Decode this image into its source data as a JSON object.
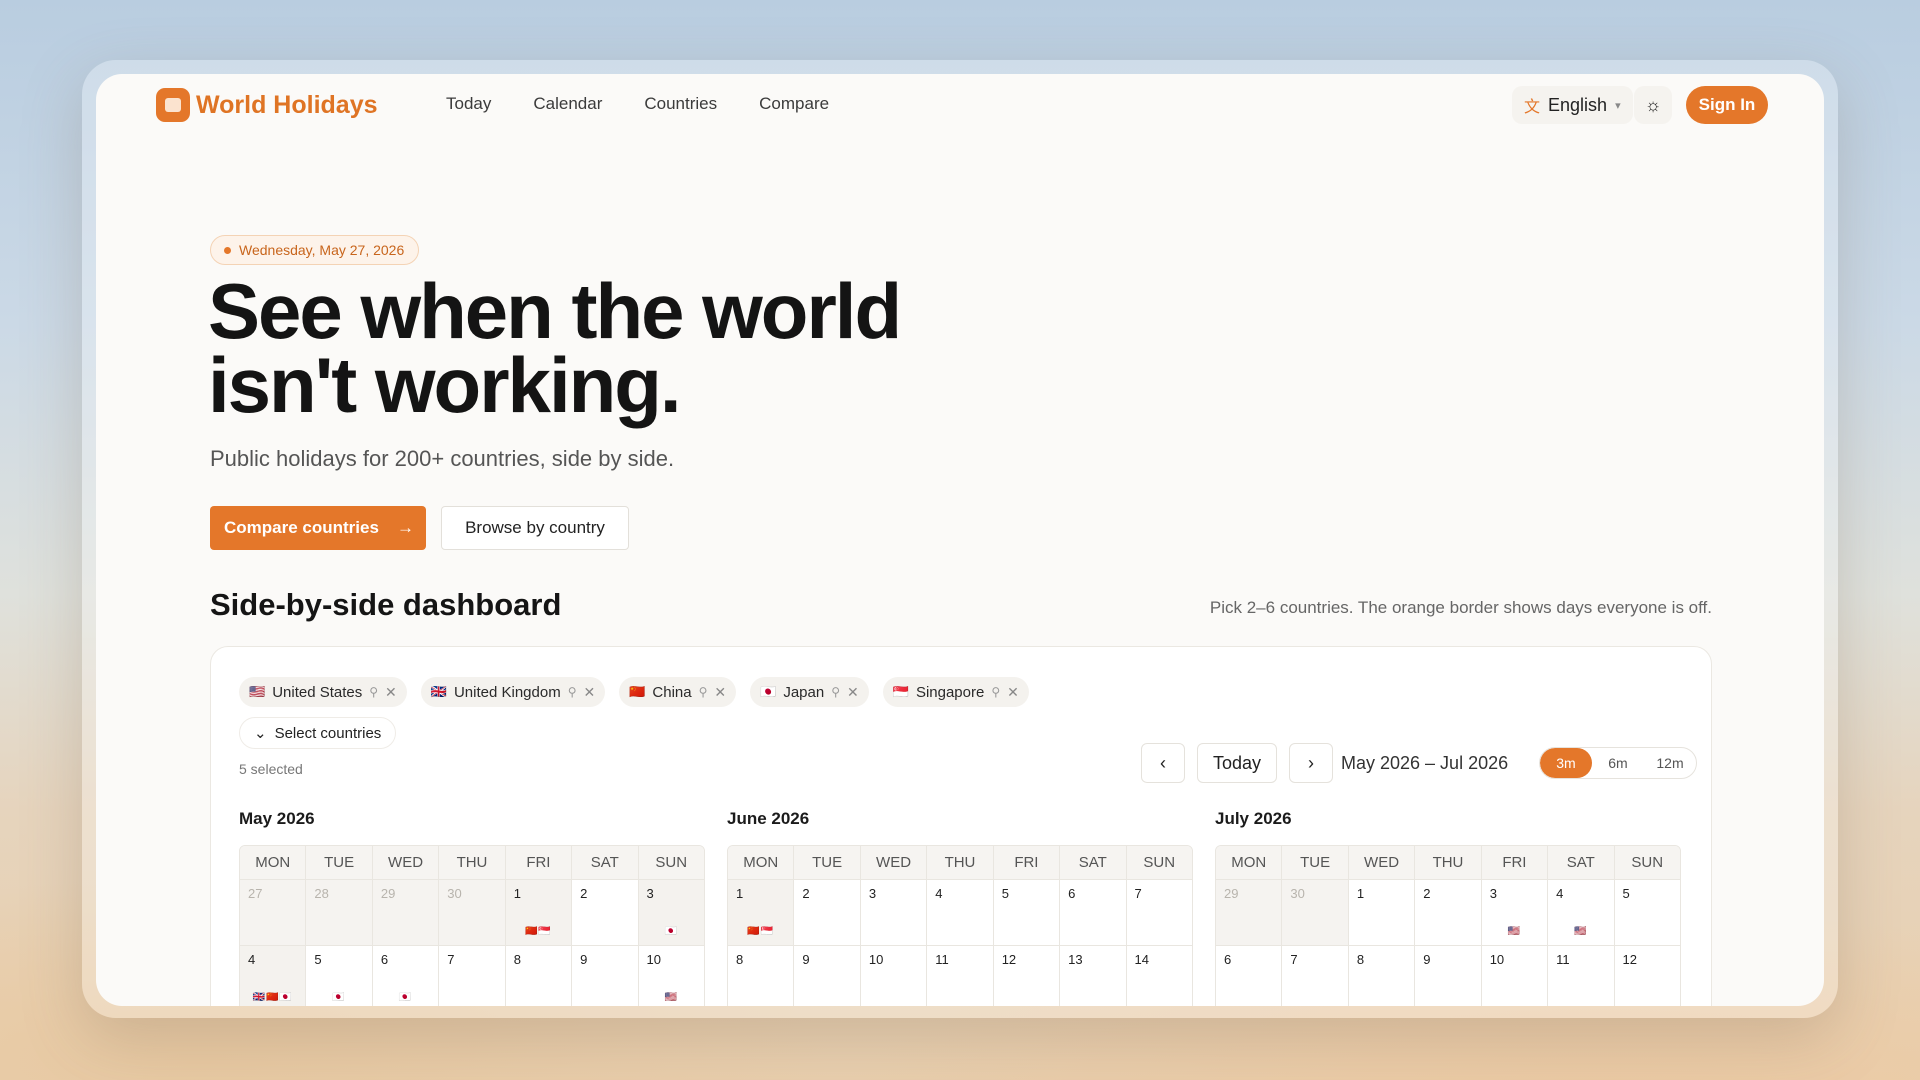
{
  "brand": {
    "name": "World Holidays",
    "accent": "#e4772a"
  },
  "nav": {
    "links": [
      "Today",
      "Calendar",
      "Countries",
      "Compare"
    ],
    "language": "English",
    "sign_in": "Sign In"
  },
  "hero": {
    "date": "Wednesday, May 27, 2026",
    "headline": "See when the world isn't working.",
    "subline": "Public holidays for 200+ countries, side by side.",
    "primary_cta": "Compare countries",
    "secondary_cta": "Browse by country"
  },
  "dashboard": {
    "title": "Side-by-side dashboard",
    "hint": "Pick 2–6 countries. The orange border shows days everyone is off.",
    "countries": [
      {
        "name": "United States",
        "flag": "🇺🇸"
      },
      {
        "name": "United Kingdom",
        "flag": "🇬🇧"
      },
      {
        "name": "China",
        "flag": "🇨🇳"
      },
      {
        "name": "Japan",
        "flag": "🇯🇵"
      },
      {
        "name": "Singapore",
        "flag": "🇸🇬"
      }
    ],
    "select_label": "Select countries",
    "selected_note": "5 selected",
    "today_label": "Today",
    "range": "May 2026 – Jul 2026",
    "spans": [
      "3m",
      "6m",
      "12m"
    ],
    "active_span": "3m",
    "weekdays": [
      "MON",
      "TUE",
      "WED",
      "THU",
      "FRI",
      "SAT",
      "SUN"
    ],
    "months": [
      {
        "title": "May 2026",
        "weeks": [
          [
            {
              "d": "27",
              "out": true
            },
            {
              "d": "28",
              "out": true
            },
            {
              "d": "29",
              "out": true
            },
            {
              "d": "30",
              "out": true
            },
            {
              "d": "1",
              "hol": true,
              "flags": "🇨🇳🇸🇬"
            },
            {
              "d": "2"
            },
            {
              "d": "3",
              "hol": true,
              "flags": "🇯🇵"
            }
          ],
          [
            {
              "d": "4",
              "hol": true,
              "flags": "🇬🇧🇨🇳🇯🇵"
            },
            {
              "d": "5",
              "flags": "🇯🇵"
            },
            {
              "d": "6",
              "flags": "🇯🇵"
            },
            {
              "d": "7"
            },
            {
              "d": "8"
            },
            {
              "d": "9"
            },
            {
              "d": "10",
              "flags": "🇺🇸"
            }
          ]
        ]
      },
      {
        "title": "June 2026",
        "weeks": [
          [
            {
              "d": "1",
              "hol": true,
              "flags": "🇨🇳🇸🇬"
            },
            {
              "d": "2"
            },
            {
              "d": "3"
            },
            {
              "d": "4"
            },
            {
              "d": "5"
            },
            {
              "d": "6"
            },
            {
              "d": "7"
            }
          ],
          [
            {
              "d": "8"
            },
            {
              "d": "9"
            },
            {
              "d": "10"
            },
            {
              "d": "11"
            },
            {
              "d": "12"
            },
            {
              "d": "13"
            },
            {
              "d": "14"
            }
          ]
        ]
      },
      {
        "title": "July 2026",
        "weeks": [
          [
            {
              "d": "29",
              "out": true
            },
            {
              "d": "30",
              "out": true
            },
            {
              "d": "1"
            },
            {
              "d": "2"
            },
            {
              "d": "3",
              "flags": "🇺🇸"
            },
            {
              "d": "4",
              "flags": "🇺🇸"
            },
            {
              "d": "5"
            }
          ],
          [
            {
              "d": "6"
            },
            {
              "d": "7"
            },
            {
              "d": "8"
            },
            {
              "d": "9"
            },
            {
              "d": "10"
            },
            {
              "d": "11"
            },
            {
              "d": "12"
            }
          ]
        ]
      }
    ]
  }
}
